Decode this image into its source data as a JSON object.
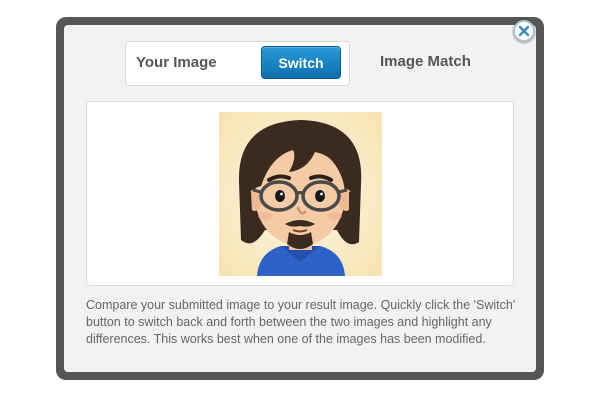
{
  "modal": {
    "close_icon": "close-x-icon",
    "toggle": {
      "your_image_label": "Your Image",
      "switch_label": "Switch",
      "image_match_label": "Image Match"
    },
    "image": {
      "subject": "cartoon avatar of a man with long brown hair, round glasses and a goatee, wearing a blue shirt"
    },
    "description": "Compare your submitted image to your result image. Quickly click the 'Switch' button to switch back and forth between the two images and highlight any differences. This works best when one of the images has been modified."
  },
  "colors": {
    "frame": "#565656",
    "panel": "#f2f2f2",
    "switch_button": "#1a7fc1",
    "label_text": "#555555",
    "body_text": "#666666"
  }
}
